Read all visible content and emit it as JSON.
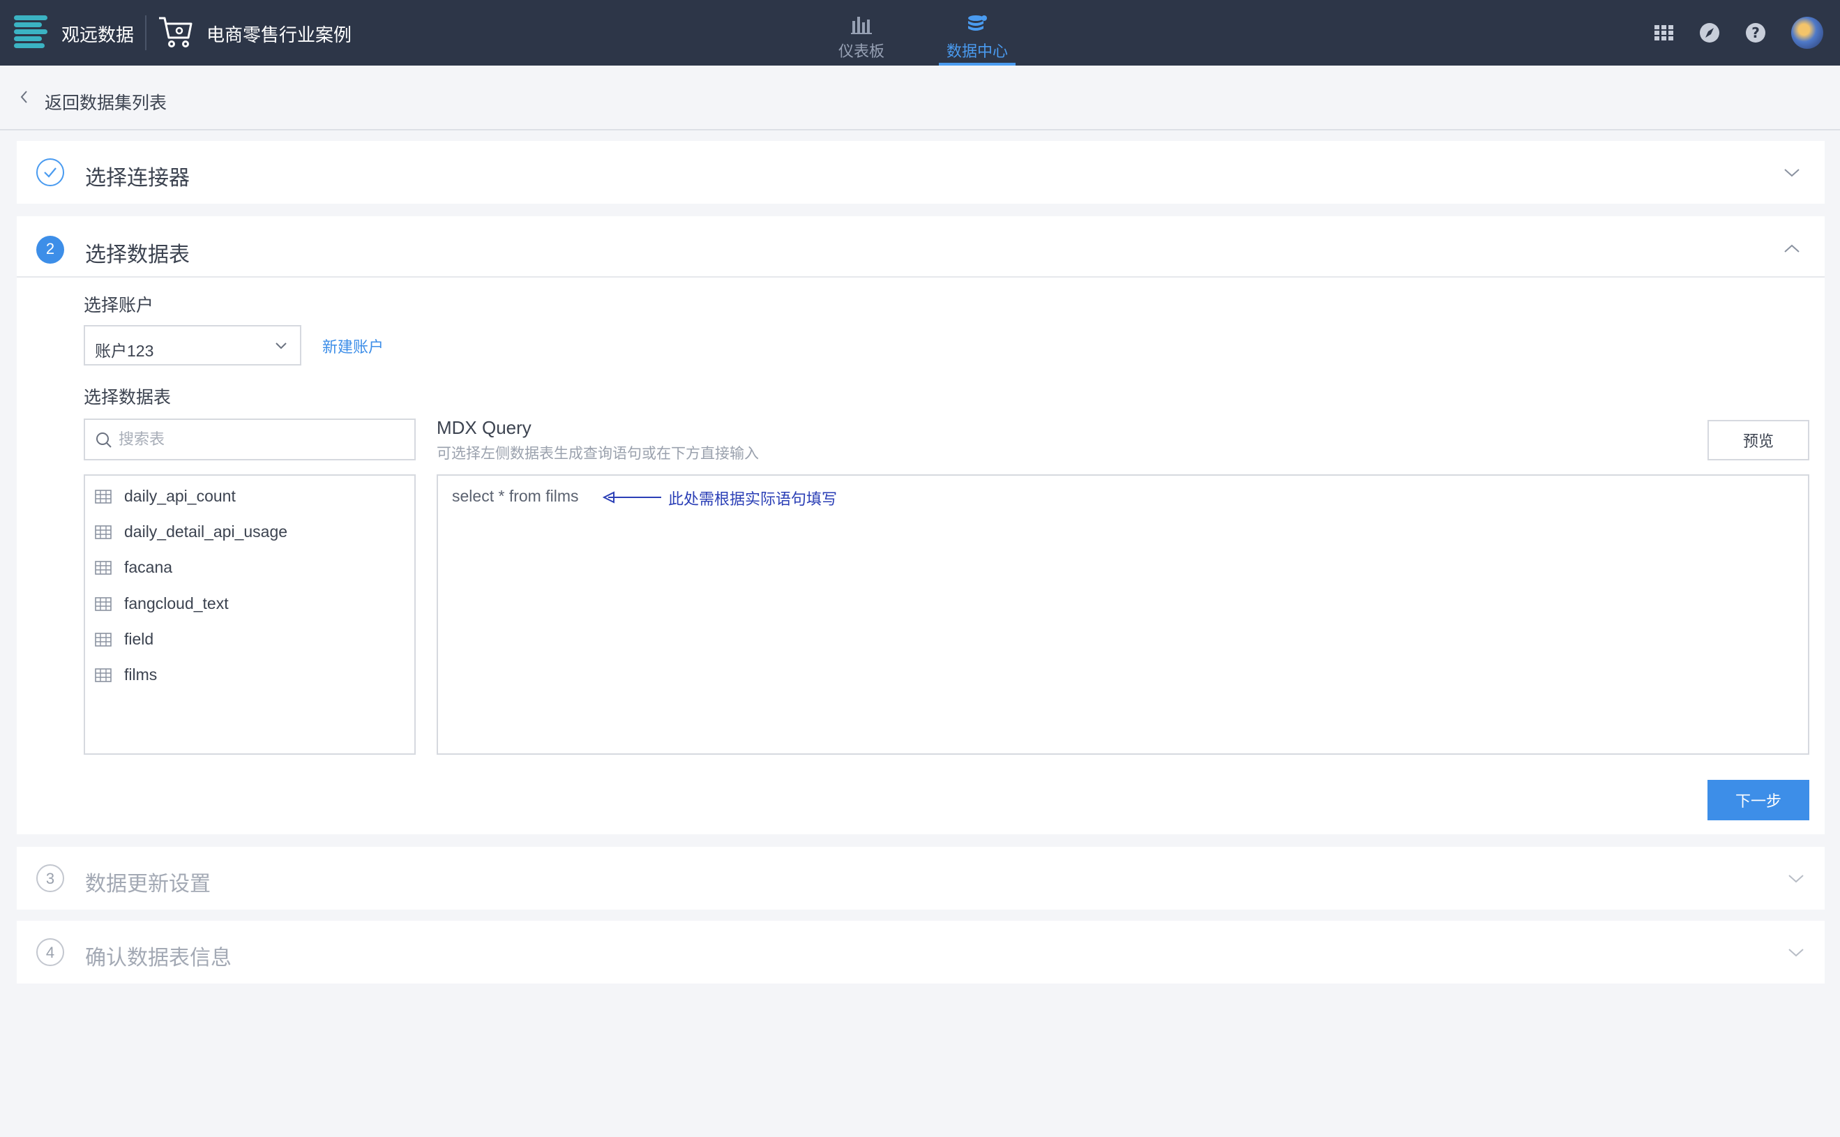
{
  "topbar": {
    "brand": "观远数据",
    "project": "电商零售行业案例",
    "tabs": [
      {
        "label": "仪表板",
        "icon": "bar-chart-icon",
        "active": false
      },
      {
        "label": "数据中心",
        "icon": "database-icon",
        "active": true
      }
    ],
    "right_icons": [
      "apps-grid-icon",
      "compass-icon",
      "help-icon",
      "avatar"
    ],
    "accent_color": "#4a9bf0",
    "bg_color": "#2d3648"
  },
  "back": {
    "label": "返回数据集列表"
  },
  "steps": [
    {
      "number": "",
      "title": "选择连接器",
      "state": "done"
    },
    {
      "number": "2",
      "title": "选择数据表",
      "state": "active"
    },
    {
      "number": "3",
      "title": "数据更新设置",
      "state": "pending"
    },
    {
      "number": "4",
      "title": "确认数据表信息",
      "state": "pending"
    }
  ],
  "account": {
    "label": "选择账户",
    "selected": "账户123",
    "new_account": "新建账户"
  },
  "tables": {
    "label": "选择数据表",
    "search_placeholder": "搜索表",
    "items": [
      "daily_api_count",
      "daily_detail_api_usage",
      "facana",
      "fangcloud_text",
      "field",
      "films"
    ]
  },
  "mdx": {
    "title": "MDX Query",
    "subtitle": "可选择左侧数据表生成查询语句或在下方直接输入",
    "preview_button": "预览",
    "query": "select * from films",
    "annotation": "此处需根据实际语句填写",
    "annotation_color": "#2b3fb6"
  },
  "footer": {
    "next_button": "下一步"
  }
}
